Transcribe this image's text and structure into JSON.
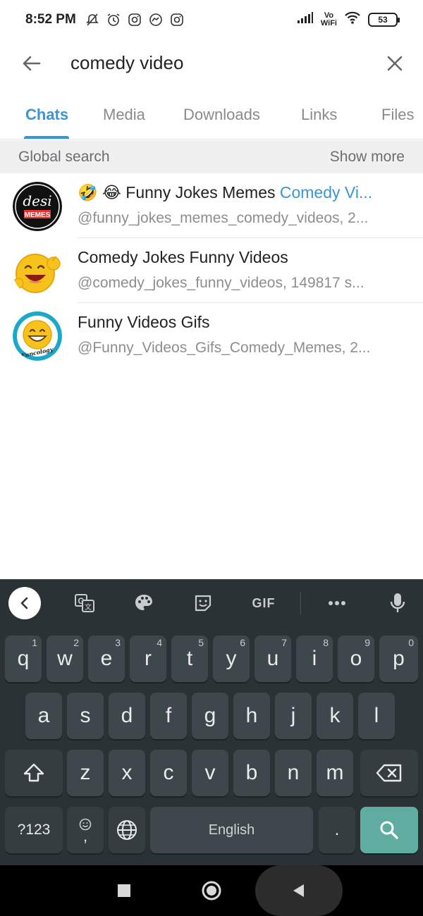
{
  "status_bar": {
    "time": "8:52 PM",
    "volte_top": "Vo",
    "volte_bottom": "WiFi",
    "battery": "53",
    "left_icons": [
      "mute-icon",
      "alarm-icon",
      "instagram-icon",
      "messenger-icon",
      "instagram-icon"
    ],
    "right_icons": [
      "signal-icon",
      "wifi-icon",
      "battery-icon"
    ]
  },
  "search": {
    "query": "comedy video",
    "back_icon": "arrow-left-icon",
    "clear_icon": "close-icon"
  },
  "tabs": [
    {
      "label": "Chats",
      "active": true
    },
    {
      "label": "Media",
      "active": false
    },
    {
      "label": "Downloads",
      "active": false
    },
    {
      "label": "Links",
      "active": false
    },
    {
      "label": "Files",
      "active": false
    }
  ],
  "section": {
    "title": "Global search",
    "action": "Show more"
  },
  "results": [
    {
      "title_prefix": "🤣 😂 Funny Jokes Memes ",
      "title_highlight": "Comedy Vi...",
      "subtitle": "@funny_jokes_memes_comedy_videos, 2...",
      "avatar_text_top": "desi",
      "avatar_text_bottom": "MEMES"
    },
    {
      "title_prefix": "Comedy Jokes Funny Videos",
      "title_highlight": "",
      "subtitle": "@comedy_jokes_funny_videos, 149817 s...",
      "avatar_text_top": "",
      "avatar_text_bottom": ""
    },
    {
      "title_prefix": "Funny Videos Gifs",
      "title_highlight": "",
      "subtitle": "@Funny_Videos_Gifs_Comedy_Memes, 2...",
      "avatar_text_top": "",
      "avatar_text_bottom": "Funcology"
    }
  ],
  "keyboard": {
    "toolbar": [
      "collapse-icon",
      "translate-icon",
      "palette-icon",
      "sticker-icon",
      "GIF",
      "more-icon",
      "mic-icon"
    ],
    "gif_label": "GIF",
    "row1": [
      {
        "k": "q",
        "h": "1"
      },
      {
        "k": "w",
        "h": "2"
      },
      {
        "k": "e",
        "h": "3"
      },
      {
        "k": "r",
        "h": "4"
      },
      {
        "k": "t",
        "h": "5"
      },
      {
        "k": "y",
        "h": "6"
      },
      {
        "k": "u",
        "h": "7"
      },
      {
        "k": "i",
        "h": "8"
      },
      {
        "k": "o",
        "h": "9"
      },
      {
        "k": "p",
        "h": "0"
      }
    ],
    "row2": [
      "a",
      "s",
      "d",
      "f",
      "g",
      "h",
      "j",
      "k",
      "l"
    ],
    "row3": [
      "z",
      "x",
      "c",
      "v",
      "b",
      "n",
      "m"
    ],
    "sym_label": "?123",
    "comma_label": ",",
    "space_label": "English",
    "period_label": "."
  },
  "colors": {
    "accent": "#3a95d5",
    "keyboard_bg": "#2a3236",
    "key_bg": "#3e474b",
    "search_key": "#5fada1"
  }
}
